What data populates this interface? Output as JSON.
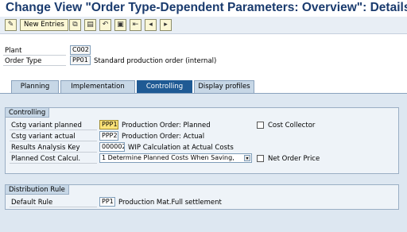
{
  "window": {
    "title": "Change View \"Order Type-Dependent Parameters: Overview\": Details"
  },
  "toolbar": {
    "new_entries_label": "New Entries",
    "icons": [
      "change-display-icon",
      "copy-icon",
      "delete-icon",
      "undo-icon",
      "select-icon",
      "first-page-icon",
      "previous-page-icon",
      "next-page-icon"
    ]
  },
  "header": {
    "plant_label": "Plant",
    "plant_value": "C002",
    "order_type_label": "Order Type",
    "order_type_value": "PP01",
    "order_type_desc": "Standard production order (internal)"
  },
  "tabs": [
    {
      "label": "Planning"
    },
    {
      "label": "Implementation"
    },
    {
      "label": "Controlling"
    },
    {
      "label": "Display profiles"
    }
  ],
  "controlling": {
    "title": "Controlling",
    "cstg_planned_label": "Cstg variant planned",
    "cstg_planned_value": "PPP1",
    "cstg_planned_desc": "Production Order: Planned",
    "cstg_actual_label": "Cstg variant actual",
    "cstg_actual_value": "PPP2",
    "cstg_actual_desc": "Production Order: Actual",
    "results_label": "Results Analysis Key",
    "results_value": "000002",
    "results_desc": "WIP Calculation at Actual Costs",
    "planned_cost_label": "Planned Cost Calcul.",
    "planned_cost_value": "1 Determine Planned Costs When Saving,",
    "cost_collector_label": "Cost Collector",
    "net_order_price_label": "Net Order Price"
  },
  "distribution": {
    "title": "Distribution Rule",
    "default_rule_label": "Default Rule",
    "default_rule_value": "PP1",
    "default_rule_desc": "Production Mat.Full settlement"
  },
  "colors": {
    "title_text": "#1a3b6e",
    "active_tab": "#1f5a94",
    "focused_field": "#ffe57a"
  }
}
